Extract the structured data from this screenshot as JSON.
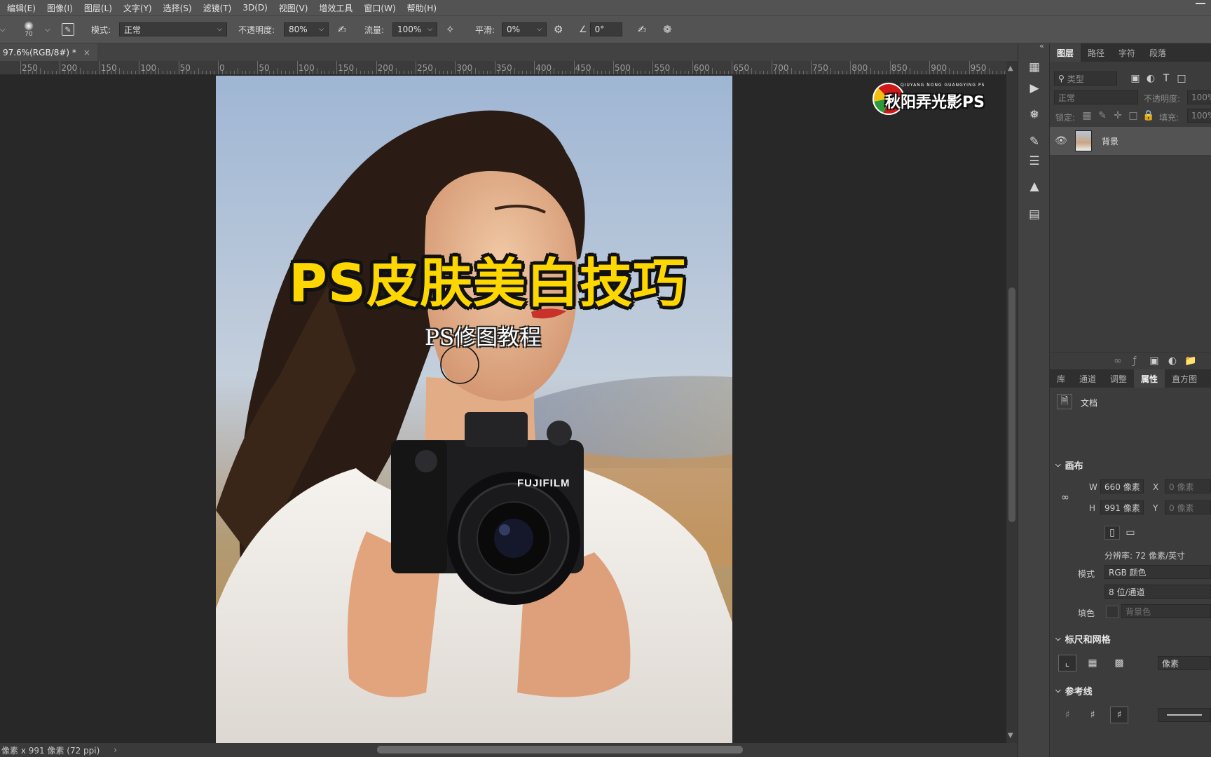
{
  "menubar": {
    "items": [
      "编辑(E)",
      "图像(I)",
      "图层(L)",
      "文字(Y)",
      "选择(S)",
      "滤镜(T)",
      "3D(D)",
      "视图(V)",
      "增效工具",
      "窗口(W)",
      "帮助(H)"
    ]
  },
  "options": {
    "brush_size": "70",
    "mode_label": "模式:",
    "mode_value": "正常",
    "opacity_label": "不透明度:",
    "opacity_value": "80%",
    "flow_label": "流量:",
    "flow_value": "100%",
    "smooth_label": "平滑:",
    "smooth_value": "0%",
    "angle_value": "0°"
  },
  "document": {
    "tab_title": "97.6%(RGB/8#) *",
    "close_glyph": "×"
  },
  "ruler": {
    "labels": [
      "250",
      "200",
      "150",
      "100",
      "50",
      "0",
      "50",
      "100",
      "150",
      "200",
      "250",
      "300",
      "350",
      "400",
      "450",
      "500",
      "550",
      "600",
      "650",
      "700",
      "750",
      "800",
      "850",
      "900",
      "950"
    ]
  },
  "canvas": {
    "headline": "PS皮肤美白技巧",
    "subtitle": "PS修图教程",
    "camera_brand": "FUJIFILM",
    "watermark": "秋阳弄光影PS",
    "watermark_small": "QIUYANG NONG GUANGYING PS"
  },
  "status": {
    "info": "像素 x 991 像素 (72 ppi)",
    "arrow": "›"
  },
  "layers_panel": {
    "tabs": [
      "图层",
      "路径",
      "字符",
      "段落"
    ],
    "active_tab": 0,
    "filter_placeholder": "类型",
    "blend_mode": "正常",
    "opacity_label": "不透明度:",
    "opacity_value": "100%",
    "lock_label": "锁定:",
    "fill_label": "填充:",
    "fill_value": "100%",
    "layer_name": "背景"
  },
  "properties_panel": {
    "tabs": [
      "库",
      "通道",
      "调整",
      "属性",
      "直方图"
    ],
    "active_tab": 3,
    "doc_label": "文档",
    "canvas_section": "画布",
    "w_label": "W",
    "w_value": "660 像素",
    "h_label": "H",
    "h_value": "991 像素",
    "x_label": "X",
    "x_value": "0 像素",
    "y_label": "Y",
    "y_value": "0 像素",
    "resolution": "分辨率: 72 像素/英寸",
    "mode_label": "模式",
    "mode_value": "RGB 颜色",
    "depth_value": "8 位/通道",
    "fill_label": "填色",
    "fill_value": "背景色",
    "rulers_section": "标尺和网格",
    "unit_value": "像素",
    "guides_section": "参考线"
  },
  "colors": {
    "ui_bg": "#535353",
    "panel_bg": "#3c3c3c",
    "workspace": "#282828",
    "headline_yellow": "#ffd700",
    "accent_red": "#d01818"
  }
}
